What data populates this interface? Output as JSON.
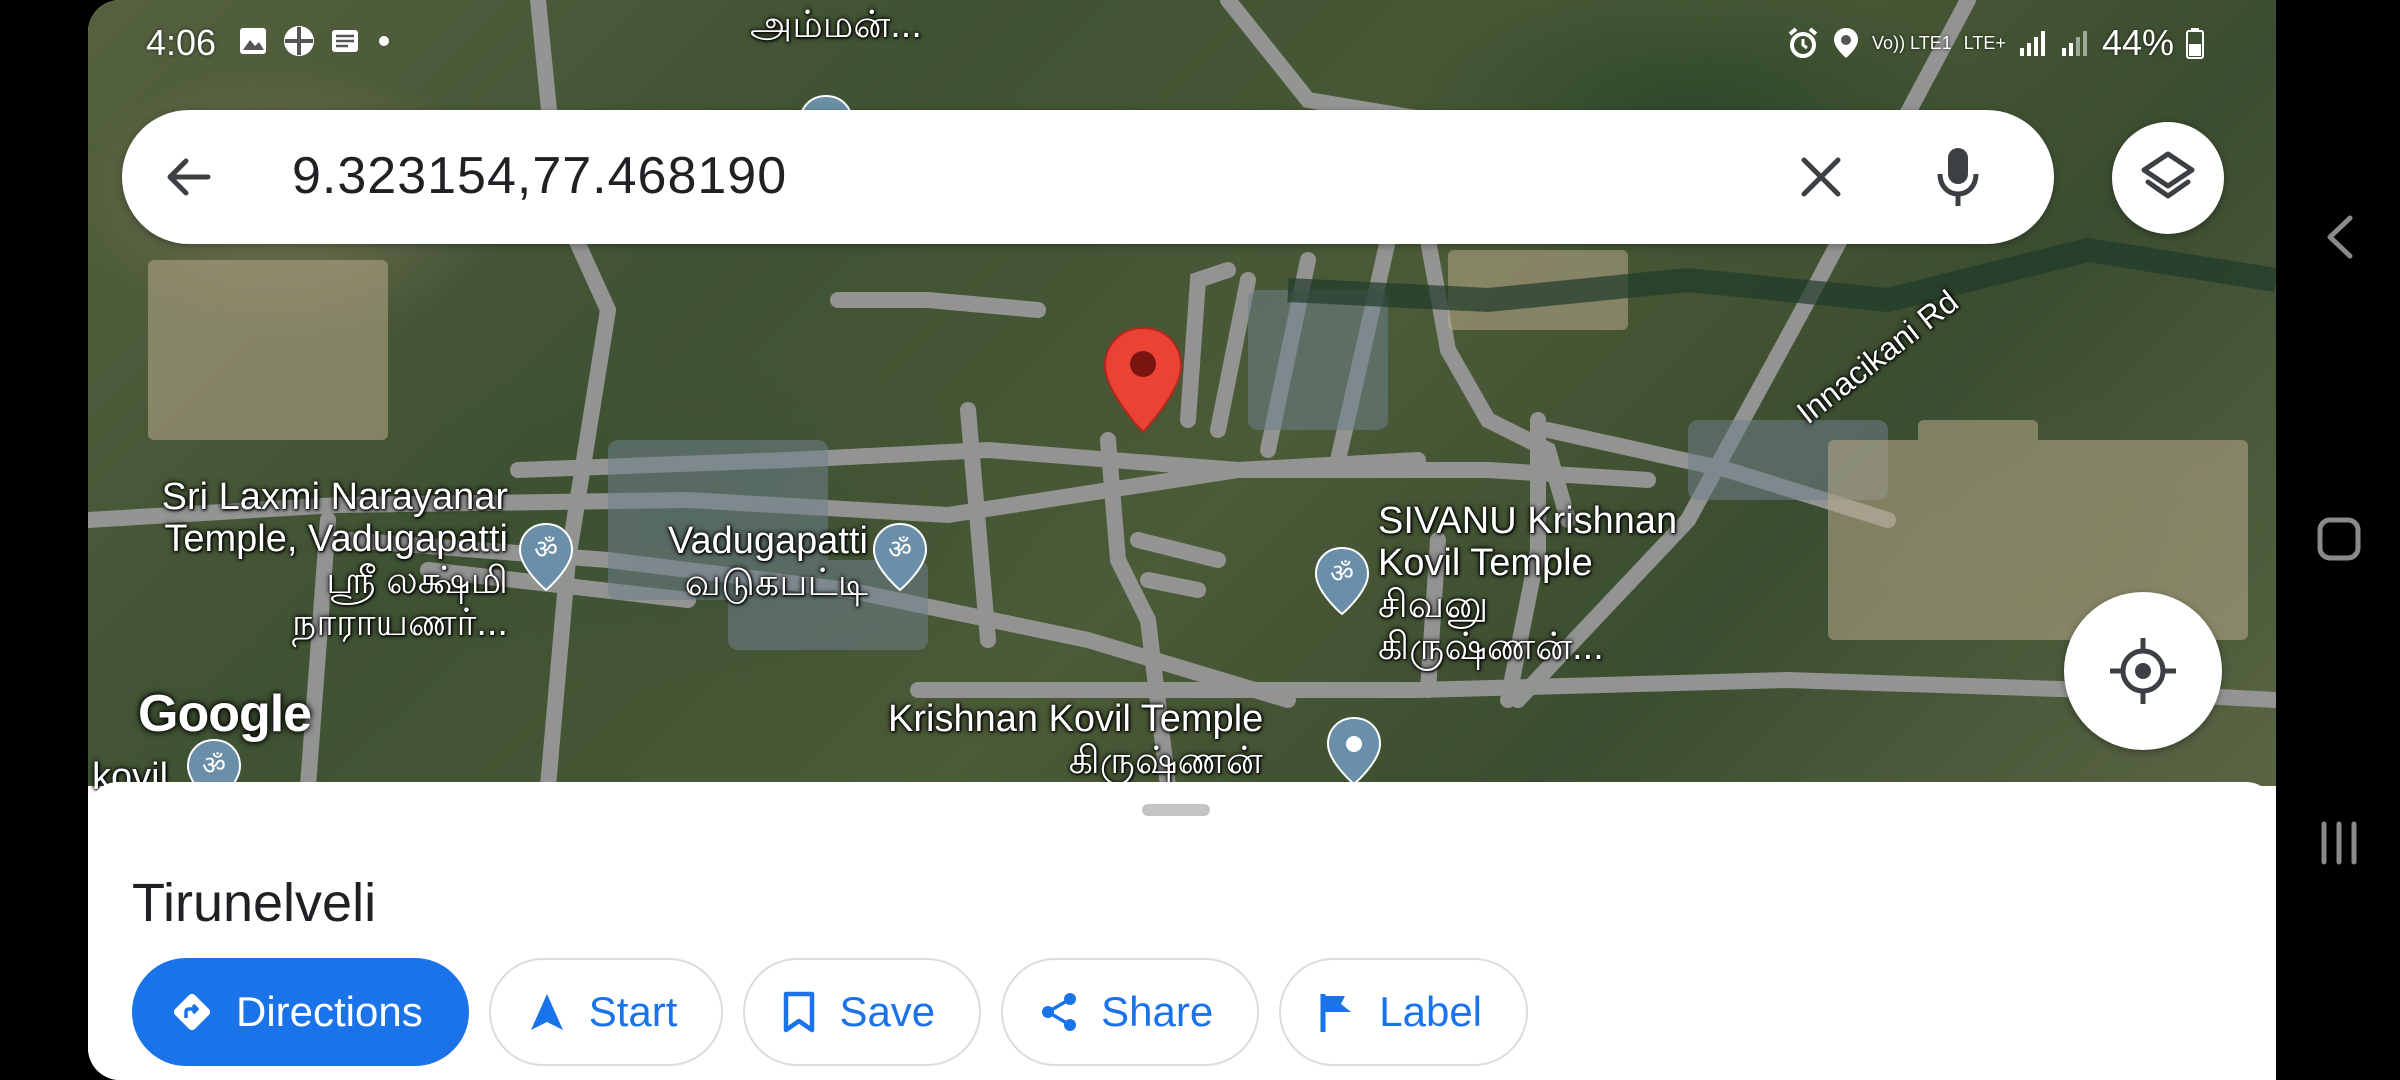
{
  "status_bar": {
    "time": "4:06",
    "battery": "44%",
    "network": "LTE+",
    "volte": "Vo)) LTE1",
    "left_icons": [
      "image-icon",
      "grid-app-icon",
      "news-icon",
      "dot-icon"
    ],
    "right_icons": [
      "alarm-icon",
      "location-icon",
      "signal-icon",
      "signal-r-icon",
      "battery-icon"
    ]
  },
  "search": {
    "query": "9.323154,77.468190"
  },
  "map": {
    "labels": {
      "top_temple": "அம்மன்...",
      "sri_laxmi_1": "Sri Laxmi Narayanar",
      "sri_laxmi_2": "Temple, Vadugapatti",
      "sri_laxmi_3": "ஸ்ரீ லக்ஷ்மி",
      "sri_laxmi_4": "நாராயணர்...",
      "vadugapatti_1": "Vadugapatti",
      "vadugapatti_2": "வடுகபட்டி",
      "sivanu_1": "SIVANU Krishnan",
      "sivanu_2": "Kovil Temple",
      "sivanu_3": "சிவனு",
      "sivanu_4": "கிருஷ்ணன்...",
      "krishnan_1": "Krishnan Kovil Temple",
      "krishnan_2": "கிருஷ்ணன்",
      "road": "Innacikani Rd",
      "kovil": "kovil"
    },
    "logo": "Google",
    "colors": {
      "pin": "#ea4335",
      "road": "#9e9e9e",
      "poi": "#6b8fa8"
    }
  },
  "sheet": {
    "place_name": "Tirunelveli",
    "actions": [
      {
        "label": "Directions",
        "icon": "directions-icon"
      },
      {
        "label": "Start",
        "icon": "navigation-arrow-icon"
      },
      {
        "label": "Save",
        "icon": "bookmark-icon"
      },
      {
        "label": "Share",
        "icon": "share-icon"
      },
      {
        "label": "Label",
        "icon": "flag-icon"
      }
    ]
  },
  "theme": {
    "accent": "#1a73e8",
    "text": "#202124"
  }
}
